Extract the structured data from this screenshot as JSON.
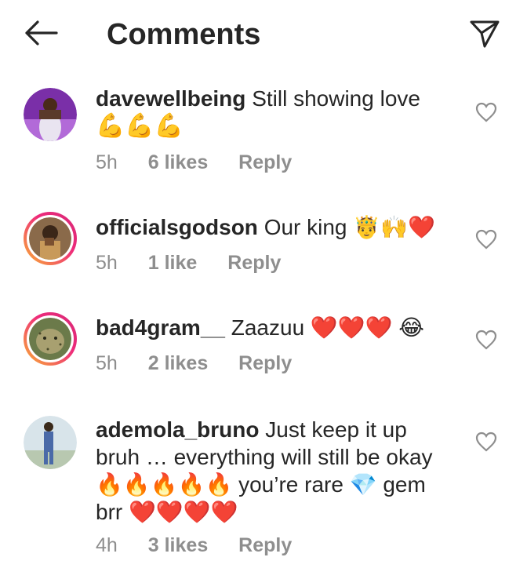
{
  "header": {
    "title": "Comments"
  },
  "comments": [
    {
      "username": "davewellbeing",
      "text": "Still showing love",
      "text2": "💪💪💪",
      "time": "5h",
      "likes": "6 likes",
      "reply": "Reply"
    },
    {
      "username": "officialsgodson",
      "text": "Our king 🤴🙌❤️",
      "time": "5h",
      "likes": "1 like",
      "reply": "Reply"
    },
    {
      "username": "bad4gram__",
      "text": "Zaazuu ❤️❤️❤️ 😂",
      "time": "5h",
      "likes": "2 likes",
      "reply": "Reply"
    },
    {
      "username": "ademola_bruno",
      "text": "Just keep it up bruh … everything will still be okay 🔥🔥🔥🔥🔥 you’re rare 💎 gem brr ❤️❤️❤️❤️",
      "time": "4h",
      "likes": "3 likes",
      "reply": "Reply"
    }
  ],
  "icons": {
    "back": "arrow-left-icon",
    "send": "paper-plane-icon",
    "like": "heart-outline-icon"
  },
  "colors": {
    "text": "#262626",
    "meta": "#8e8e8e",
    "story_ring_start": "#f9b233",
    "story_ring_end": "#d62976"
  }
}
